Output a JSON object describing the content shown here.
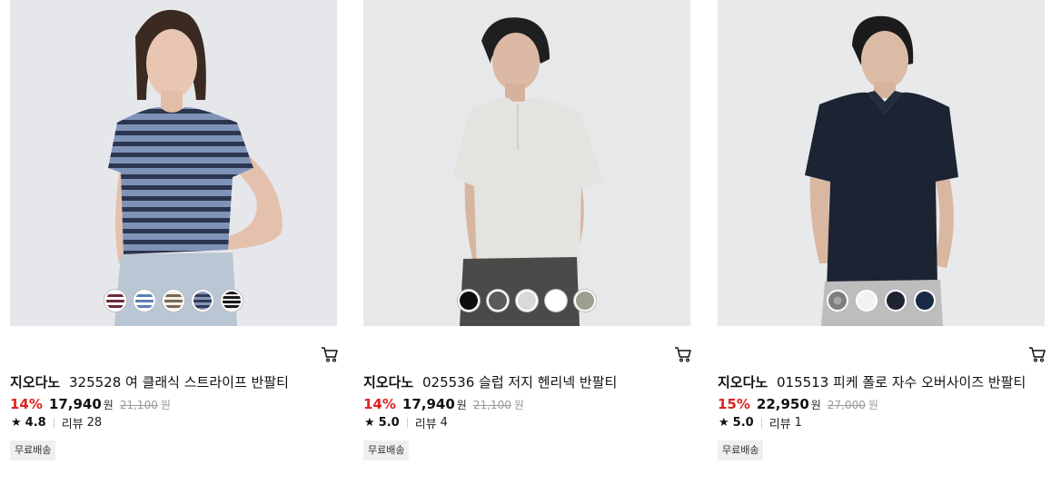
{
  "products": [
    {
      "brand": "지오다노",
      "name": "325528 여 클래식 스트라이프 반팔티",
      "discount": "14%",
      "sale_price": "17,940",
      "currency": "원",
      "original_price": "21,100",
      "rating": "4.8",
      "review_label": "리뷰",
      "review_count": "28",
      "badge": "무료배송",
      "swatches": [
        "#6b2b3a",
        "#5d7fb5",
        "#7a6a55",
        "#4a5a7a",
        "#1a1a1a"
      ]
    },
    {
      "brand": "지오다노",
      "name": "025536 슬럽 저지 헨리넥 반팔티",
      "discount": "14%",
      "sale_price": "17,940",
      "currency": "원",
      "original_price": "21,100",
      "rating": "5.0",
      "review_label": "리뷰",
      "review_count": "4",
      "badge": "무료배송",
      "swatches": [
        "#0d0d0d",
        "#5b5b5b",
        "#d9d9d9",
        "#ffffff",
        "#9aa08c"
      ]
    },
    {
      "brand": "지오다노",
      "name": "015513 피케 폴로 자수 오버사이즈 반팔티",
      "discount": "15%",
      "sale_price": "22,950",
      "currency": "원",
      "original_price": "27,000",
      "rating": "5.0",
      "review_label": "리뷰",
      "review_count": "1",
      "badge": "무료배송",
      "swatches": [
        "#8d8d8d",
        "#f2f2f2",
        "#1e2430",
        "#1b2a44"
      ]
    }
  ],
  "icons": {
    "cart": "cart-icon",
    "star": "star-icon"
  },
  "colors": {
    "discount": "#e0201f",
    "badge_bg": "#efefef",
    "photo_bg": "#e9eaec"
  }
}
